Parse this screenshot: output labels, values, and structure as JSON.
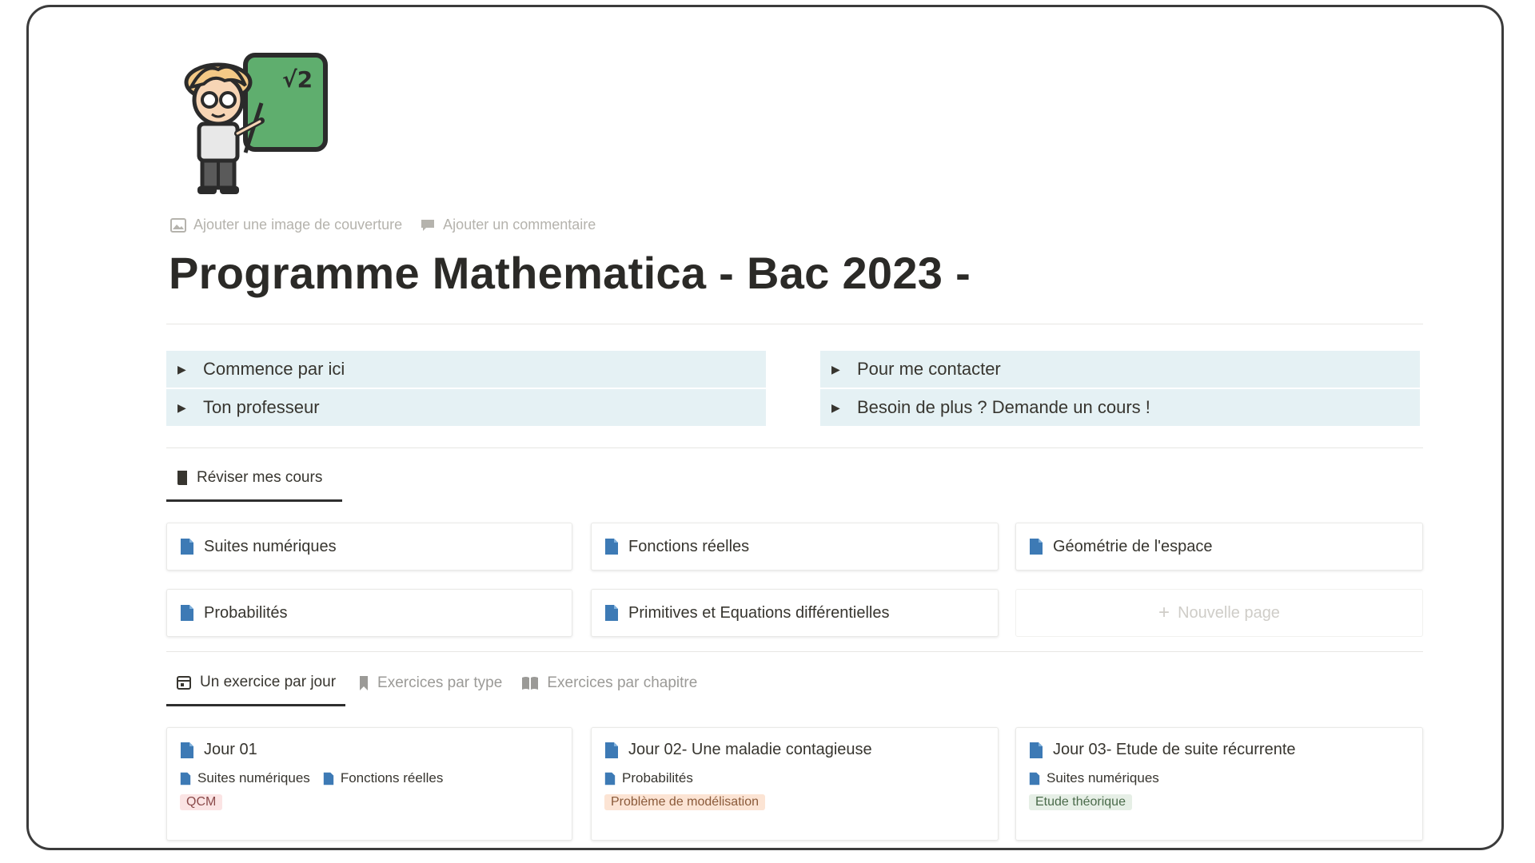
{
  "page": {
    "title": "Programme Mathematica - Bac 2023 -",
    "actions": {
      "add_cover": "Ajouter une image de couverture",
      "add_comment": "Ajouter un commentaire"
    }
  },
  "toggles": {
    "left": [
      "Commence par ici",
      "Ton professeur"
    ],
    "right": [
      "Pour me contacter",
      "Besoin de plus ? Demande un cours !"
    ]
  },
  "courses": {
    "tab_label": "Réviser mes cours",
    "items": [
      "Suites numériques",
      "Fonctions réelles",
      "Géométrie de l'espace",
      "Probabilités",
      "Primitives et Equations différentielles"
    ],
    "new_page_label": "Nouvelle page"
  },
  "exercises": {
    "tabs": [
      "Un exercice par jour",
      "Exercices par type",
      "Exercices par chapitre"
    ],
    "cards": [
      {
        "title": "Jour 01",
        "relations": [
          "Suites numériques",
          "Fonctions réelles"
        ],
        "tag": "QCM"
      },
      {
        "title": "Jour 02- Une maladie contagieuse",
        "relations": [
          "Probabilités"
        ],
        "tag": "Problème de modélisation"
      },
      {
        "title": "Jour 03- Etude de suite récurrente",
        "relations": [
          "Suites numériques"
        ],
        "tag": "Etude théorique"
      }
    ]
  },
  "colors": {
    "toggle_bg": "#e5f1f4",
    "page_icon_blue": "#3d7ab5",
    "tag_qcm_bg": "#fbe4e4",
    "tag_modelisation_bg": "#fce4d4",
    "tag_theorique_bg": "#e6efe6"
  },
  "icons": {
    "page_icon": "teacher-with-chalkboard-icon",
    "cover": "image-icon",
    "comment": "comment-icon",
    "course_page": "blue-document-icon",
    "calendar": "calendar-icon",
    "bookmark": "bookmark-icon",
    "book": "open-book-icon",
    "plus": "plus-icon"
  }
}
